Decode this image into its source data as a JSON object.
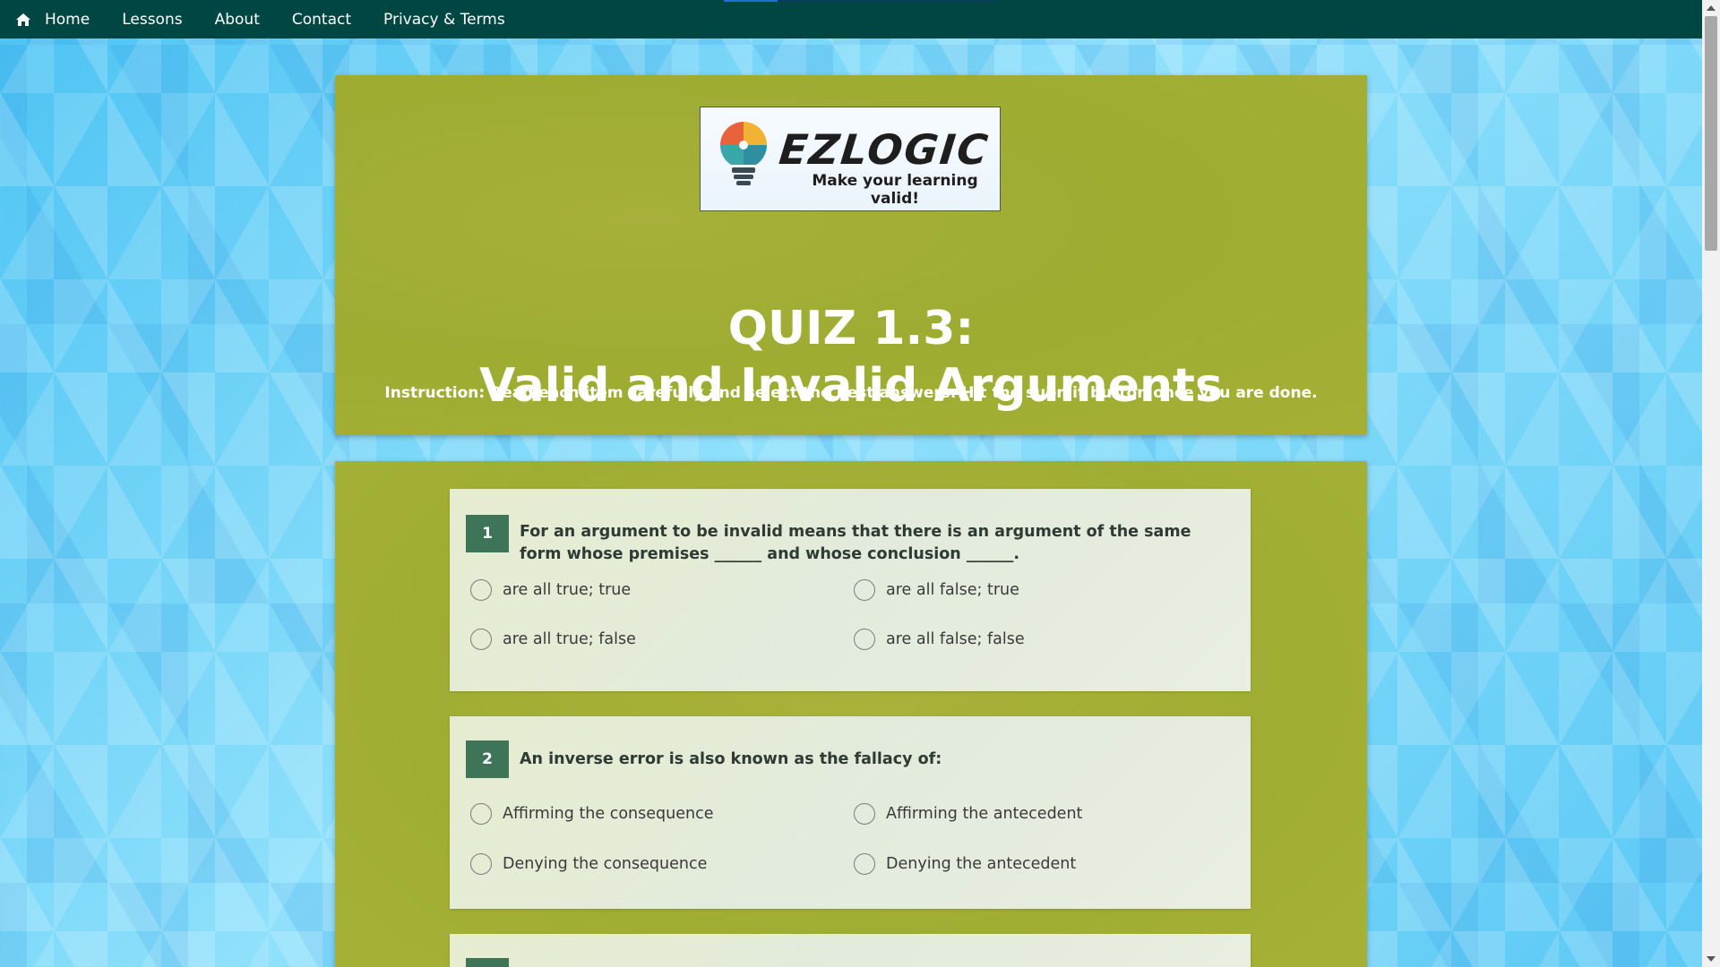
{
  "nav": {
    "items": [
      {
        "label": "Home",
        "icon": "home-icon"
      },
      {
        "label": "Lessons"
      },
      {
        "label": "About"
      },
      {
        "label": "Contact"
      },
      {
        "label": "Privacy & Terms"
      }
    ]
  },
  "header": {
    "logo_word": "EZLOGIC",
    "logo_tagline": "Make your learning valid!",
    "title_line1": "QUIZ 1.3:",
    "title_line2": "Valid and Invalid Arguments",
    "instruction": "Instruction: Read each item carefully and select the best answers. Hit the submit button once you are done."
  },
  "questions": [
    {
      "number": "1",
      "text": "For an argument to be invalid means that there is an argument of the same form whose premises ______ and whose conclusion ______.",
      "options": [
        "are all true; true",
        "are all false; true",
        "are all true; false",
        "are all false; false"
      ]
    },
    {
      "number": "2",
      "text": "An inverse error is also known as the fallacy of:",
      "options": [
        "Affirming the consequence",
        "Affirming the antecedent",
        "Denying the consequence",
        "Denying the antecedent"
      ]
    }
  ],
  "colors": {
    "nav_bg": "#004743",
    "card_bg": "#a2ae35",
    "question_badge": "#3e7458"
  }
}
